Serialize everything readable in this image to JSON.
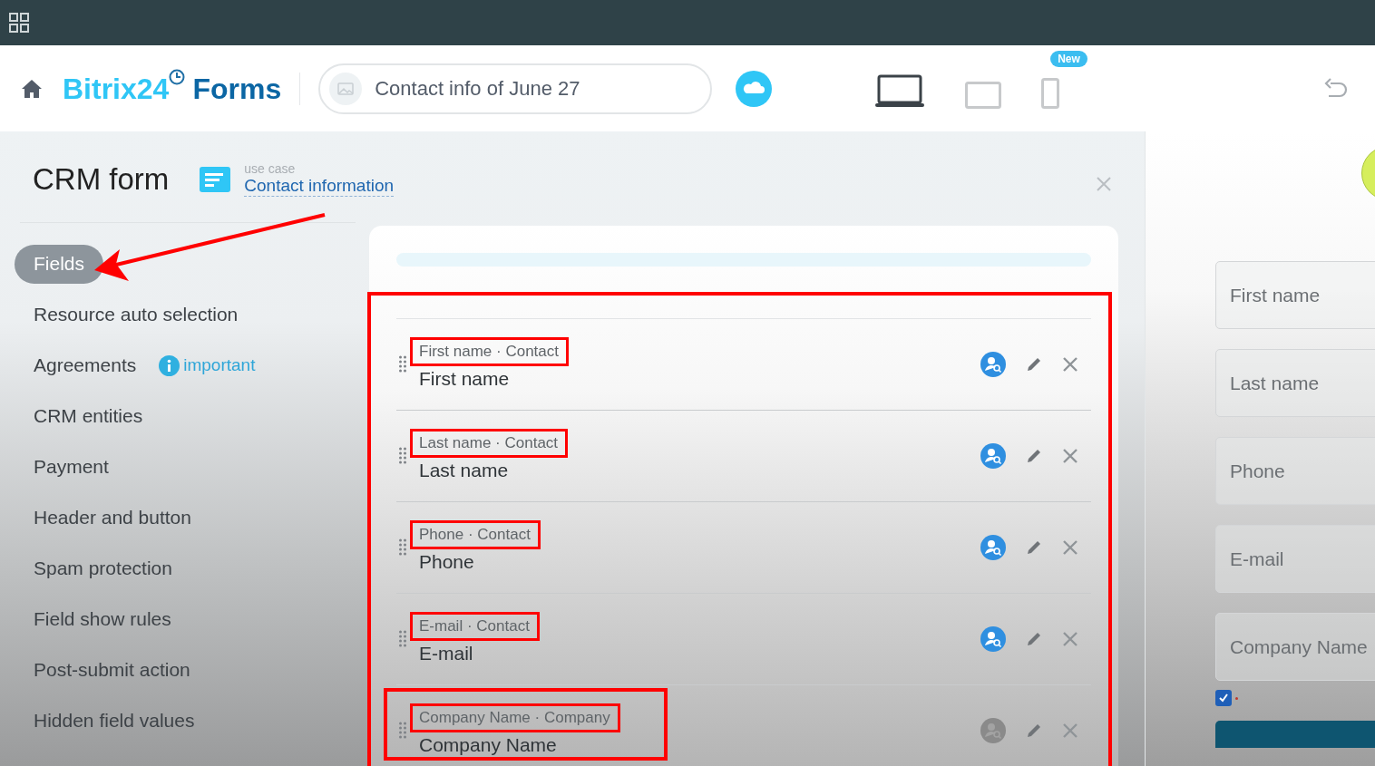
{
  "header": {
    "brand_main": "Bitrix24",
    "brand_sub": "Forms",
    "form_name": "Contact info of June 27",
    "devices": [
      {
        "kind": "laptop",
        "selected": true
      },
      {
        "kind": "tablet",
        "selected": false
      },
      {
        "kind": "phone",
        "selected": false,
        "badge": "New"
      }
    ]
  },
  "panel": {
    "title": "CRM form",
    "use_case_label": "use case",
    "use_case": "Contact information"
  },
  "sidebar": {
    "items": [
      {
        "label": "Fields",
        "selected": true,
        "pointed": true
      },
      {
        "label": "Resource auto selection",
        "selected": false
      },
      {
        "label": "Agreements",
        "selected": false,
        "note": "important"
      },
      {
        "label": "CRM entities",
        "selected": false
      },
      {
        "label": "Payment",
        "selected": false
      },
      {
        "label": "Header and button",
        "selected": false
      },
      {
        "label": "Spam protection",
        "selected": false
      },
      {
        "label": "Field show rules",
        "selected": false
      },
      {
        "label": "Post-submit action",
        "selected": false
      },
      {
        "label": "Hidden field values",
        "selected": false
      }
    ]
  },
  "fields": {
    "highlighted": true,
    "rows": [
      {
        "type": "First name · Contact",
        "name": "First name",
        "linked": true,
        "highlighted": true,
        "row_highlighted": false
      },
      {
        "type": "Last name · Contact",
        "name": "Last name",
        "linked": true,
        "highlighted": true,
        "row_highlighted": false
      },
      {
        "type": "Phone · Contact",
        "name": "Phone",
        "linked": true,
        "highlighted": true,
        "row_highlighted": false
      },
      {
        "type": "E-mail · Contact",
        "name": "E-mail",
        "linked": true,
        "highlighted": true,
        "row_highlighted": false
      },
      {
        "type": "Company Name · Company",
        "name": "Company Name",
        "linked": false,
        "highlighted": true,
        "row_highlighted": true
      }
    ]
  },
  "preview": {
    "inputs": [
      {
        "placeholder": "First name"
      },
      {
        "placeholder": "Last name"
      },
      {
        "placeholder": "Phone"
      },
      {
        "placeholder": "E-mail"
      },
      {
        "placeholder": "Company Name"
      }
    ],
    "consent_checked": true
  }
}
